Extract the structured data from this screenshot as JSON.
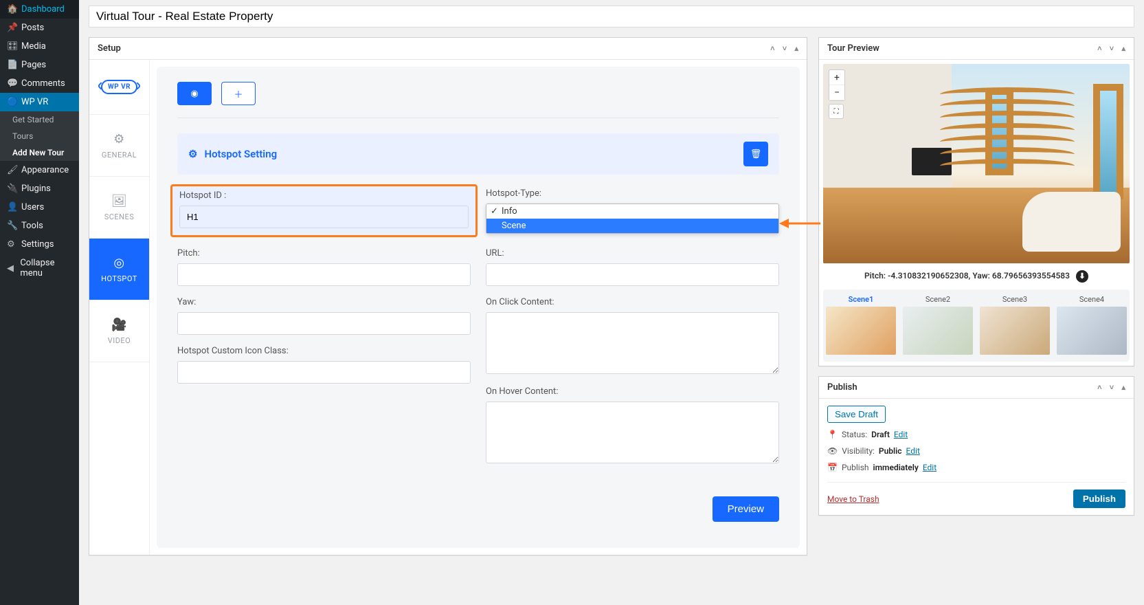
{
  "sidebar": {
    "items": [
      {
        "label": "Dashboard",
        "icon": "🏠"
      },
      {
        "label": "Posts",
        "icon": "📌"
      },
      {
        "label": "Media",
        "icon": "🎛"
      },
      {
        "label": "Pages",
        "icon": "📄"
      },
      {
        "label": "Comments",
        "icon": "💬"
      },
      {
        "label": "WP VR",
        "icon": "🔵",
        "active": true
      },
      {
        "label": "Appearance",
        "icon": "🖌"
      },
      {
        "label": "Plugins",
        "icon": "🔌"
      },
      {
        "label": "Users",
        "icon": "👤"
      },
      {
        "label": "Tools",
        "icon": "🔧"
      },
      {
        "label": "Settings",
        "icon": "⚙"
      },
      {
        "label": "Collapse menu",
        "icon": "◀"
      }
    ],
    "submenu": [
      {
        "label": "Get Started"
      },
      {
        "label": "Tours"
      },
      {
        "label": "Add New Tour",
        "current": true
      }
    ]
  },
  "page": {
    "title_value": "Virtual Tour - Real Estate Property"
  },
  "setup_box": {
    "title": "Setup",
    "tabs": {
      "logo_text": "WP VR",
      "general": "GENERAL",
      "scenes": "SCENES",
      "hotspot": "HOTSPOT",
      "video": "VIDEO"
    },
    "content": {
      "setting_title": "Hotspot Setting",
      "fields": {
        "hotspot_id": {
          "label": "Hotspot ID :",
          "value": "H1"
        },
        "hotspot_type": {
          "label": "Hotspot-Type:",
          "options": [
            "Info",
            "Scene"
          ],
          "selected": "Info",
          "highlighted": "Scene"
        },
        "pitch": {
          "label": "Pitch:"
        },
        "url": {
          "label": "URL:"
        },
        "yaw": {
          "label": "Yaw:"
        },
        "on_click": {
          "label": "On Click Content:"
        },
        "icon_class": {
          "label": "Hotspot Custom Icon Class:"
        },
        "on_hover": {
          "label": "On Hover Content:"
        }
      },
      "preview_btn": "Preview"
    }
  },
  "tour_preview": {
    "title": "Tour Preview",
    "coords": {
      "pitch_label": "Pitch:",
      "pitch": "-4.310832190652308",
      "yaw_label": "Yaw:",
      "yaw": "68.79656393554583"
    },
    "thumbs": [
      "Scene1",
      "Scene2",
      "Scene3",
      "Scene4"
    ]
  },
  "publish": {
    "title": "Publish",
    "save_draft": "Save Draft",
    "status_label": "Status:",
    "status_value": "Draft",
    "visibility_label": "Visibility:",
    "visibility_value": "Public",
    "schedule_label": "Publish",
    "schedule_value": "immediately",
    "edit": "Edit",
    "move_trash": "Move to Trash",
    "publish_btn": "Publish"
  }
}
